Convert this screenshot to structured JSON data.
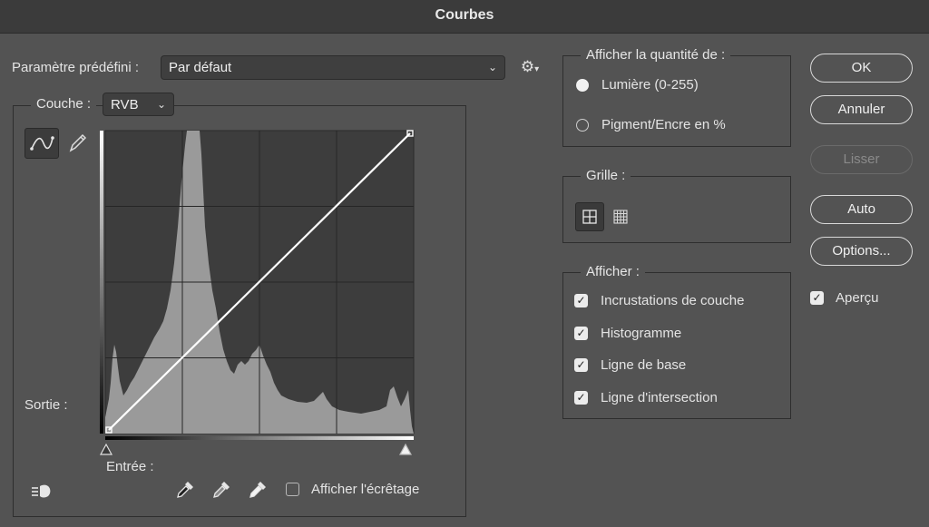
{
  "window": {
    "title": "Courbes"
  },
  "preset": {
    "label": "Paramètre prédéfini :",
    "value": "Par défaut"
  },
  "channel": {
    "label": "Couche :",
    "value": "RVB"
  },
  "curve": {
    "output_label": "Sortie :",
    "input_label": "Entrée :",
    "show_clipping_label": "Afficher l'écrêtage",
    "show_clipping_checked": false
  },
  "amount_group": {
    "title": "Afficher la quantité de :",
    "options": [
      {
        "label": "Lumière (0-255)",
        "selected": true
      },
      {
        "label": "Pigment/Encre en %",
        "selected": false
      }
    ]
  },
  "grid_group": {
    "title": "Grille :"
  },
  "display_group": {
    "title": "Afficher :",
    "options": [
      {
        "label": "Incrustations de couche",
        "checked": true
      },
      {
        "label": "Histogramme",
        "checked": true
      },
      {
        "label": "Ligne de base",
        "checked": true
      },
      {
        "label": "Ligne d'intersection",
        "checked": true
      }
    ]
  },
  "buttons": {
    "ok": "OK",
    "cancel": "Annuler",
    "smooth": "Lisser",
    "auto": "Auto",
    "options": "Options..."
  },
  "preview": {
    "label": "Aperçu",
    "checked": true
  },
  "icons": {
    "settings": "gear-icon",
    "curve_tool": "curve-point-icon",
    "pencil_tool": "pencil-icon",
    "targeted_adjust": "hand-adjust-icon",
    "black_eyedropper": "eyedropper-black-icon",
    "gray_eyedropper": "eyedropper-gray-icon",
    "white_eyedropper": "eyedropper-white-icon",
    "grid_simple": "grid-4-icon",
    "grid_detailed": "grid-10-icon"
  },
  "colors": {
    "background": "#535353",
    "histogram": "#999999",
    "graph_bg": "#3d3d3d",
    "curve": "#ffffff"
  }
}
